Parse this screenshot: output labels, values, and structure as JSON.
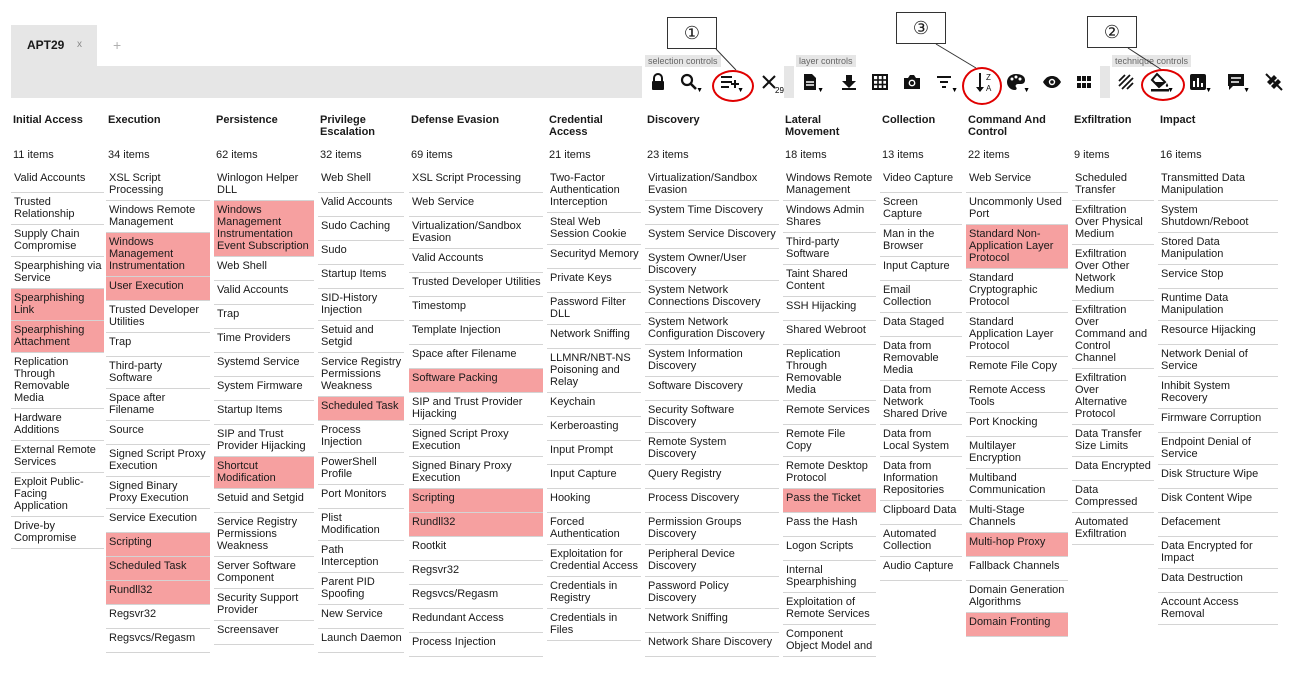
{
  "tabs": [
    {
      "label": "APT29",
      "close": "x"
    }
  ],
  "add_tab": "+",
  "annotations": {
    "one": "①",
    "two": "②",
    "three": "③",
    "highlight_color": "#e00000"
  },
  "toolbar": {
    "groups": {
      "selection": "selection controls",
      "layer": "layer controls",
      "technique": "technique controls"
    },
    "selection_buttons": [
      "lock-icon",
      "search-icon",
      "multiselect-icon",
      "deselect-icon"
    ],
    "deselect_count": "29",
    "layer_buttons": [
      "layer-info-icon",
      "download-icon",
      "grid-icon",
      "camera-icon",
      "filter-icon",
      "sort-icon",
      "color-icon",
      "eye-icon",
      "expand-icon"
    ],
    "technique_buttons": [
      "disable-icon",
      "fill-color-icon",
      "score-icon",
      "comment-icon",
      "clear-icon"
    ]
  },
  "colors": {
    "highlight": "#f6a0a0",
    "toolbar": "#e6e6e6"
  },
  "tactics": [
    {
      "name": "Initial Access",
      "count": "11 items",
      "items": [
        [
          "Valid Accounts",
          0
        ],
        [
          "Trusted Relationship",
          0
        ],
        [
          "Supply Chain Compromise",
          0
        ],
        [
          "Spearphishing via Service",
          0
        ],
        [
          "Spearphishing Link",
          1
        ],
        [
          "Spearphishing Attachment",
          1
        ],
        [
          "Replication Through Removable Media",
          0
        ],
        [
          "Hardware Additions",
          0
        ],
        [
          "External Remote Services",
          0
        ],
        [
          "Exploit Public-Facing Application",
          0
        ],
        [
          "Drive-by Compromise",
          0
        ]
      ]
    },
    {
      "name": "Execution",
      "count": "34 items",
      "items": [
        [
          "XSL Script Processing",
          0
        ],
        [
          "Windows Remote Management",
          0
        ],
        [
          "Windows Management Instrumentation",
          1
        ],
        [
          "User Execution",
          1
        ],
        [
          "Trusted Developer Utilities",
          0
        ],
        [
          "Trap",
          0
        ],
        [
          "Third-party Software",
          0
        ],
        [
          "Space after Filename",
          0
        ],
        [
          "Source",
          0
        ],
        [
          "Signed Script Proxy Execution",
          0
        ],
        [
          "Signed Binary Proxy Execution",
          0
        ],
        [
          "Service Execution",
          0
        ],
        [
          "Scripting",
          1
        ],
        [
          "Scheduled Task",
          1
        ],
        [
          "Rundll32",
          1
        ],
        [
          "Regsvr32",
          0
        ],
        [
          "Regsvcs/Regasm",
          0
        ]
      ]
    },
    {
      "name": "Persistence",
      "count": "62 items",
      "items": [
        [
          "Winlogon Helper DLL",
          0
        ],
        [
          "Windows Management Instrumentation Event Subscription",
          1
        ],
        [
          "Web Shell",
          0
        ],
        [
          "Valid Accounts",
          0
        ],
        [
          "Trap",
          0
        ],
        [
          "Time Providers",
          0
        ],
        [
          "Systemd Service",
          0
        ],
        [
          "System Firmware",
          0
        ],
        [
          "Startup Items",
          0
        ],
        [
          "SIP and Trust Provider Hijacking",
          0
        ],
        [
          "Shortcut Modification",
          1
        ],
        [
          "Setuid and Setgid",
          0
        ],
        [
          "Service Registry Permissions Weakness",
          0
        ],
        [
          "Server Software Component",
          0
        ],
        [
          "Security Support Provider",
          0
        ],
        [
          "Screensaver",
          0
        ]
      ]
    },
    {
      "name": "Privilege Escalation",
      "count": "32 items",
      "items": [
        [
          "Web Shell",
          0
        ],
        [
          "Valid Accounts",
          0
        ],
        [
          "Sudo Caching",
          0
        ],
        [
          "Sudo",
          0
        ],
        [
          "Startup Items",
          0
        ],
        [
          "SID-History Injection",
          0
        ],
        [
          "Setuid and Setgid",
          0
        ],
        [
          "Service Registry Permissions Weakness",
          0
        ],
        [
          "Scheduled Task",
          1
        ],
        [
          "Process Injection",
          0
        ],
        [
          "PowerShell Profile",
          0
        ],
        [
          "Port Monitors",
          0
        ],
        [
          "Plist Modification",
          0
        ],
        [
          "Path Interception",
          0
        ],
        [
          "Parent PID Spoofing",
          0
        ],
        [
          "New Service",
          0
        ],
        [
          "Launch Daemon",
          0
        ]
      ]
    },
    {
      "name": "Defense Evasion",
      "count": "69 items",
      "items": [
        [
          "XSL Script Processing",
          0
        ],
        [
          "Web Service",
          0
        ],
        [
          "Virtualization/Sandbox Evasion",
          0
        ],
        [
          "Valid Accounts",
          0
        ],
        [
          "Trusted Developer Utilities",
          0
        ],
        [
          "Timestomp",
          0
        ],
        [
          "Template Injection",
          0
        ],
        [
          "Space after Filename",
          0
        ],
        [
          "Software Packing",
          1
        ],
        [
          "SIP and Trust Provider Hijacking",
          0
        ],
        [
          "Signed Script Proxy Execution",
          0
        ],
        [
          "Signed Binary Proxy Execution",
          0
        ],
        [
          "Scripting",
          1
        ],
        [
          "Rundll32",
          1
        ],
        [
          "Rootkit",
          0
        ],
        [
          "Regsvr32",
          0
        ],
        [
          "Regsvcs/Regasm",
          0
        ],
        [
          "Redundant Access",
          0
        ],
        [
          "Process Injection",
          0
        ]
      ]
    },
    {
      "name": "Credential Access",
      "count": "21 items",
      "items": [
        [
          "Two-Factor Authentication Interception",
          0
        ],
        [
          "Steal Web Session Cookie",
          0
        ],
        [
          "Securityd Memory",
          0
        ],
        [
          "Private Keys",
          0
        ],
        [
          "Password Filter DLL",
          0
        ],
        [
          "Network Sniffing",
          0
        ],
        [
          "LLMNR/NBT-NS Poisoning and Relay",
          0
        ],
        [
          "Keychain",
          0
        ],
        [
          "Kerberoasting",
          0
        ],
        [
          "Input Prompt",
          0
        ],
        [
          "Input Capture",
          0
        ],
        [
          "Hooking",
          0
        ],
        [
          "Forced Authentication",
          0
        ],
        [
          "Exploitation for Credential Access",
          0
        ],
        [
          "Credentials in Registry",
          0
        ],
        [
          "Credentials in Files",
          0
        ]
      ]
    },
    {
      "name": "Discovery",
      "count": "23 items",
      "items": [
        [
          "Virtualization/Sandbox Evasion",
          0
        ],
        [
          "System Time Discovery",
          0
        ],
        [
          "System Service Discovery",
          0
        ],
        [
          "System Owner/User Discovery",
          0
        ],
        [
          "System Network Connections Discovery",
          0
        ],
        [
          "System Network Configuration Discovery",
          0
        ],
        [
          "System Information Discovery",
          0
        ],
        [
          "Software Discovery",
          0
        ],
        [
          "Security Software Discovery",
          0
        ],
        [
          "Remote System Discovery",
          0
        ],
        [
          "Query Registry",
          0
        ],
        [
          "Process Discovery",
          0
        ],
        [
          "Permission Groups Discovery",
          0
        ],
        [
          "Peripheral Device Discovery",
          0
        ],
        [
          "Password Policy Discovery",
          0
        ],
        [
          "Network Sniffing",
          0
        ],
        [
          "Network Share Discovery",
          0
        ]
      ]
    },
    {
      "name": "Lateral Movement",
      "count": "18 items",
      "items": [
        [
          "Windows Remote Management",
          0
        ],
        [
          "Windows Admin Shares",
          0
        ],
        [
          "Third-party Software",
          0
        ],
        [
          "Taint Shared Content",
          0
        ],
        [
          "SSH Hijacking",
          0
        ],
        [
          "Shared Webroot",
          0
        ],
        [
          "Replication Through Removable Media",
          0
        ],
        [
          "Remote Services",
          0
        ],
        [
          "Remote File Copy",
          0
        ],
        [
          "Remote Desktop Protocol",
          0
        ],
        [
          "Pass the Ticket",
          1
        ],
        [
          "Pass the Hash",
          0
        ],
        [
          "Logon Scripts",
          0
        ],
        [
          "Internal Spearphishing",
          0
        ],
        [
          "Exploitation of Remote Services",
          0
        ],
        [
          "Component Object Model and",
          0
        ]
      ]
    },
    {
      "name": "Collection",
      "count": "13 items",
      "items": [
        [
          "Video Capture",
          0
        ],
        [
          "Screen Capture",
          0
        ],
        [
          "Man in the Browser",
          0
        ],
        [
          "Input Capture",
          0
        ],
        [
          "Email Collection",
          0
        ],
        [
          "Data Staged",
          0
        ],
        [
          "Data from Removable Media",
          0
        ],
        [
          "Data from Network Shared Drive",
          0
        ],
        [
          "Data from Local System",
          0
        ],
        [
          "Data from Information Repositories",
          0
        ],
        [
          "Clipboard Data",
          0
        ],
        [
          "Automated Collection",
          0
        ],
        [
          "Audio Capture",
          0
        ]
      ]
    },
    {
      "name": "Command And Control",
      "count": "22 items",
      "items": [
        [
          "Web Service",
          0
        ],
        [
          "Uncommonly Used Port",
          0
        ],
        [
          "Standard Non-Application Layer Protocol",
          1
        ],
        [
          "Standard Cryptographic Protocol",
          0
        ],
        [
          "Standard Application Layer Protocol",
          0
        ],
        [
          "Remote File Copy",
          0
        ],
        [
          "Remote Access Tools",
          0
        ],
        [
          "Port Knocking",
          0
        ],
        [
          "Multilayer Encryption",
          0
        ],
        [
          "Multiband Communication",
          0
        ],
        [
          "Multi-Stage Channels",
          0
        ],
        [
          "Multi-hop Proxy",
          1
        ],
        [
          "Fallback Channels",
          0
        ],
        [
          "Domain Generation Algorithms",
          0
        ],
        [
          "Domain Fronting",
          1
        ]
      ]
    },
    {
      "name": "Exfiltration",
      "count": "9 items",
      "items": [
        [
          "Scheduled Transfer",
          0
        ],
        [
          "Exfiltration Over Physical Medium",
          0
        ],
        [
          "Exfiltration Over Other Network Medium",
          0
        ],
        [
          "Exfiltration Over Command and Control Channel",
          0
        ],
        [
          "Exfiltration Over Alternative Protocol",
          0
        ],
        [
          "Data Transfer Size Limits",
          0
        ],
        [
          "Data Encrypted",
          0
        ],
        [
          "Data Compressed",
          0
        ],
        [
          "Automated Exfiltration",
          0
        ]
      ]
    },
    {
      "name": "Impact",
      "count": "16 items",
      "items": [
        [
          "Transmitted Data Manipulation",
          0
        ],
        [
          "System Shutdown/Reboot",
          0
        ],
        [
          "Stored Data Manipulation",
          0
        ],
        [
          "Service Stop",
          0
        ],
        [
          "Runtime Data Manipulation",
          0
        ],
        [
          "Resource Hijacking",
          0
        ],
        [
          "Network Denial of Service",
          0
        ],
        [
          "Inhibit System Recovery",
          0
        ],
        [
          "Firmware Corruption",
          0
        ],
        [
          "Endpoint Denial of Service",
          0
        ],
        [
          "Disk Structure Wipe",
          0
        ],
        [
          "Disk Content Wipe",
          0
        ],
        [
          "Defacement",
          0
        ],
        [
          "Data Encrypted for Impact",
          0
        ],
        [
          "Data Destruction",
          0
        ],
        [
          "Account Access Removal",
          0
        ]
      ]
    }
  ]
}
